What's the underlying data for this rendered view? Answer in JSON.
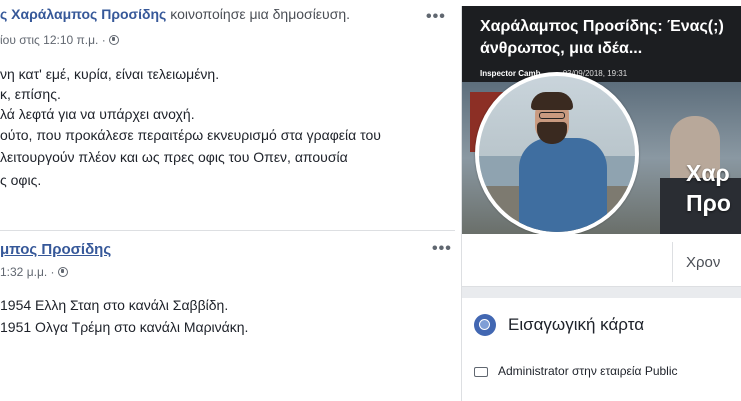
{
  "post1": {
    "author": "ς Χαράλαμπος Προσίδης",
    "action": " κοινοποίησε μια δημοσίευση.",
    "timestamp": "ίου στις 12:10 π.μ. ·",
    "lines": [
      "νη κατ' εμέ, κυρία, είναι τελειωμένη.",
      "κ, επίσης.",
      "λά λεφτά για να υπάρχει ανοχή.",
      "ούτο, που προκάλεσε περαιτέρω εκνευρισμό στα γραφεία του",
      "λειτουργούν πλέον και ως πρες οφις του Οπεν, απουσία",
      "ς οφις."
    ]
  },
  "post2": {
    "author": "μπος Προσίδης",
    "timestamp": "1:32 μ.μ. ·",
    "lines": [
      "1954 Ελλη Σταη στο κανάλι Σαββίδη.",
      "1951 Ολγα Τρέμη στο κανάλι Μαρινάκη."
    ]
  },
  "more_options": "•••",
  "profile_card": {
    "cover_title_line1": "Χαράλαμπος Προσίδης: Ένας(;)",
    "cover_title_line2": "άνθρωπος, μια ιδέα...",
    "cover_source": "Inspector Camb",
    "cover_date": "03/09/2018, 19:31",
    "page_name_line1": "Χαρ",
    "page_name_line2": "Προ",
    "timeline_tab": "Χρον",
    "intro_title": "Εισαγωγική κάρτα",
    "intro_row": "Administrator στην εταιρεία Public"
  },
  "colors": {
    "link": "#365899",
    "text": "#1d2129",
    "meta": "#616770",
    "divider": "#dddfe2",
    "accent": "#4267b2"
  },
  "icons": [
    "globe-icon",
    "more-icon",
    "intro-icon",
    "briefcase-icon"
  ]
}
